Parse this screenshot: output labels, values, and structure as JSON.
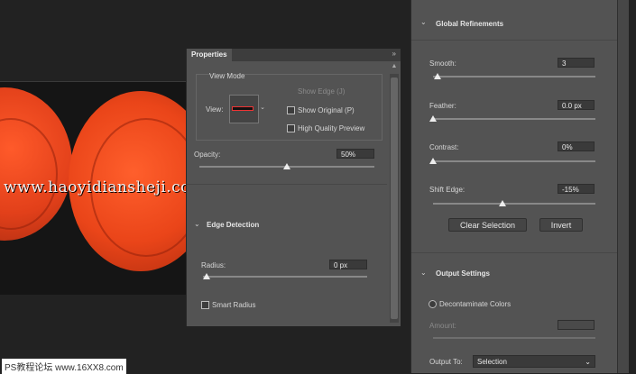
{
  "canvas": {
    "watermark_site": "www.haoyidiansheji.com",
    "watermark_ps": "PS教程论坛 www.16XX8.com"
  },
  "properties": {
    "tab_label": "Properties",
    "collapse_glyph": "»",
    "view_mode": {
      "header": "View Mode",
      "view_label": "View:",
      "show_edge": "Show Edge (J)",
      "show_original": "Show Original (P)",
      "high_quality_preview": "High Quality Preview"
    },
    "opacity": {
      "label": "Opacity:",
      "value": "50%",
      "fraction": 0.5
    },
    "edge_detection": {
      "header": "Edge Detection",
      "radius_label": "Radius:",
      "radius_value": "0 px",
      "smart_radius": "Smart Radius"
    }
  },
  "global_refinements": {
    "header": "Global Refinements",
    "smooth": {
      "label": "Smooth:",
      "value": "3",
      "fraction": 0.03
    },
    "feather": {
      "label": "Feather:",
      "value": "0.0 px",
      "fraction": 0.0
    },
    "contrast": {
      "label": "Contrast:",
      "value": "0%",
      "fraction": 0.0
    },
    "shift_edge": {
      "label": "Shift Edge:",
      "value": "-15%",
      "fraction": 0.425
    },
    "clear_selection": "Clear Selection",
    "invert": "Invert"
  },
  "output_settings": {
    "header": "Output Settings",
    "decontaminate": "Decontaminate Colors",
    "amount_label": "Amount:",
    "output_to_label": "Output To:",
    "output_to_value": "Selection"
  },
  "icons": {
    "chevron": "chevron-down-icon",
    "dropdown": "dropdown-arrow-icon",
    "scroll_up": "scroll-up-arrow-icon"
  }
}
